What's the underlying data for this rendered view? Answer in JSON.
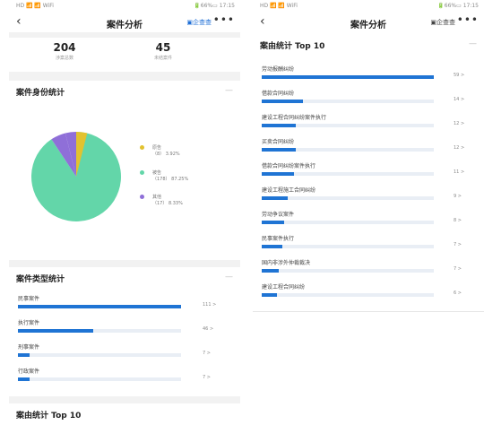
{
  "left": {
    "status_left": "HD 📶 📶 WiFi",
    "status_right": "🔋66%▭ 17:15",
    "nav_title": "案件分析",
    "export_label": "企查查",
    "stats": [
      {
        "value": "204",
        "label": "涉案总数"
      },
      {
        "value": "45",
        "label": "未结案件"
      }
    ],
    "identity": {
      "title": "案件身份统计",
      "legend": [
        {
          "name": "原告",
          "detail": "（8）  3.92%",
          "color": "#e2c22f"
        },
        {
          "name": "被告",
          "detail": "（178）  87.25%",
          "color": "#63d6a9"
        },
        {
          "name": "其他",
          "detail": "（17）  8.33%",
          "color": "#8f6fd8"
        }
      ]
    },
    "type_stats": {
      "title": "案件类型统计",
      "items": [
        {
          "label": "民事案件",
          "count": "111 >",
          "ratio": 1.0
        },
        {
          "label": "执行案件",
          "count": "46 >",
          "ratio": 0.46
        },
        {
          "label": "刑事案件",
          "count": "7 >",
          "ratio": 0.07
        },
        {
          "label": "行政案件",
          "count": "7 >",
          "ratio": 0.07
        }
      ]
    },
    "cause_title": "案由统计 Top 10"
  },
  "right": {
    "status_left": "HD 📶 📶 WiFi",
    "status_right": "🔋66%▭ 17:15",
    "nav_title": "案件分析",
    "export_label": "企查查",
    "cause": {
      "title": "案由统计 Top 10",
      "items": [
        {
          "label": "劳动报酬纠纷",
          "count": "59 >",
          "ratio": 1.0
        },
        {
          "label": "借款合同纠纷",
          "count": "14 >",
          "ratio": 0.24
        },
        {
          "label": "建设工程合同纠纷案件执行",
          "count": "12 >",
          "ratio": 0.2
        },
        {
          "label": "买卖合同纠纷",
          "count": "12 >",
          "ratio": 0.2
        },
        {
          "label": "借款合同纠纷案件执行",
          "count": "11 >",
          "ratio": 0.19
        },
        {
          "label": "建设工程施工合同纠纷",
          "count": "9 >",
          "ratio": 0.15
        },
        {
          "label": "劳动争议案件",
          "count": "8 >",
          "ratio": 0.13
        },
        {
          "label": "民事案件执行",
          "count": "7 >",
          "ratio": 0.12
        },
        {
          "label": "国内非涉外仲裁裁决",
          "count": "7 >",
          "ratio": 0.1
        },
        {
          "label": "建设工程合同纠纷",
          "count": "6 >",
          "ratio": 0.09
        }
      ]
    }
  }
}
